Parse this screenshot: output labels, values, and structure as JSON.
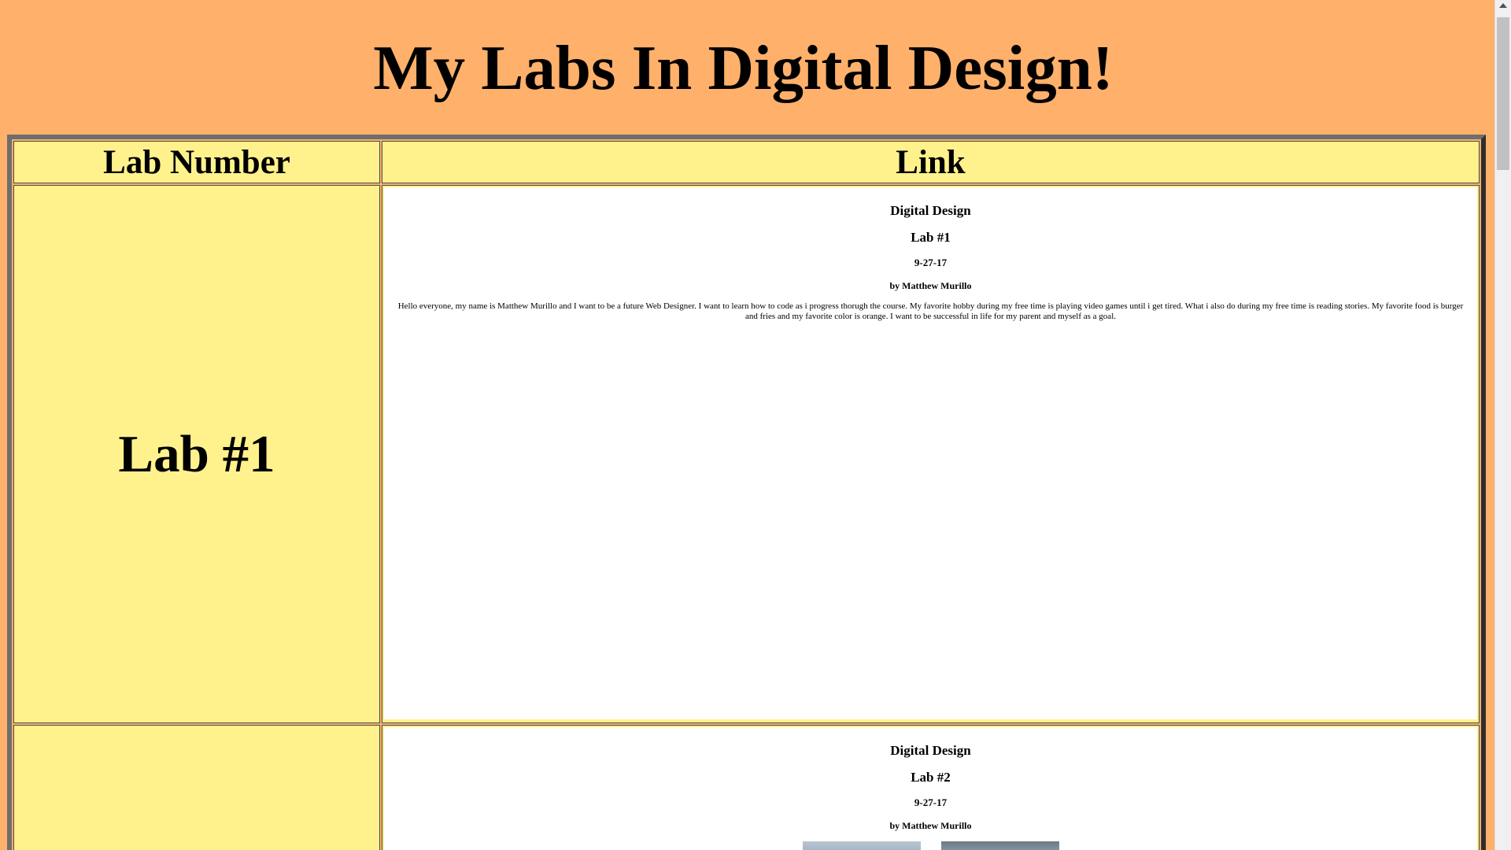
{
  "page": {
    "title": "My Labs In Digital Design!"
  },
  "table": {
    "headers": [
      "Lab Number",
      "Link"
    ],
    "rows": [
      {
        "lab": "Lab #1",
        "frame": {
          "course": "Digital Design",
          "lab": "Lab #1",
          "date": "9-27-17",
          "author": "by Matthew Murillo",
          "bio": "Hello everyone, my name is Matthew Murillo and I want to be a future Web Designer. I want to learn how to code as i progress thorugh the course. My favorite hobby during my free time is playing video games until i get tired. What i also do during my free time is reading stories. My favorite food is burger and fries and my favorite color is orange. I want to be successful in life for my parent and myself as a goal."
        }
      },
      {
        "lab": "",
        "frame": {
          "course": "Digital Design",
          "lab": "Lab #2",
          "date": "9-27-17",
          "author": "by Matthew Murillo"
        }
      }
    ]
  },
  "colors": {
    "background": "#ffb06a",
    "cell": "#fff28c",
    "frame": "#ffffff"
  }
}
